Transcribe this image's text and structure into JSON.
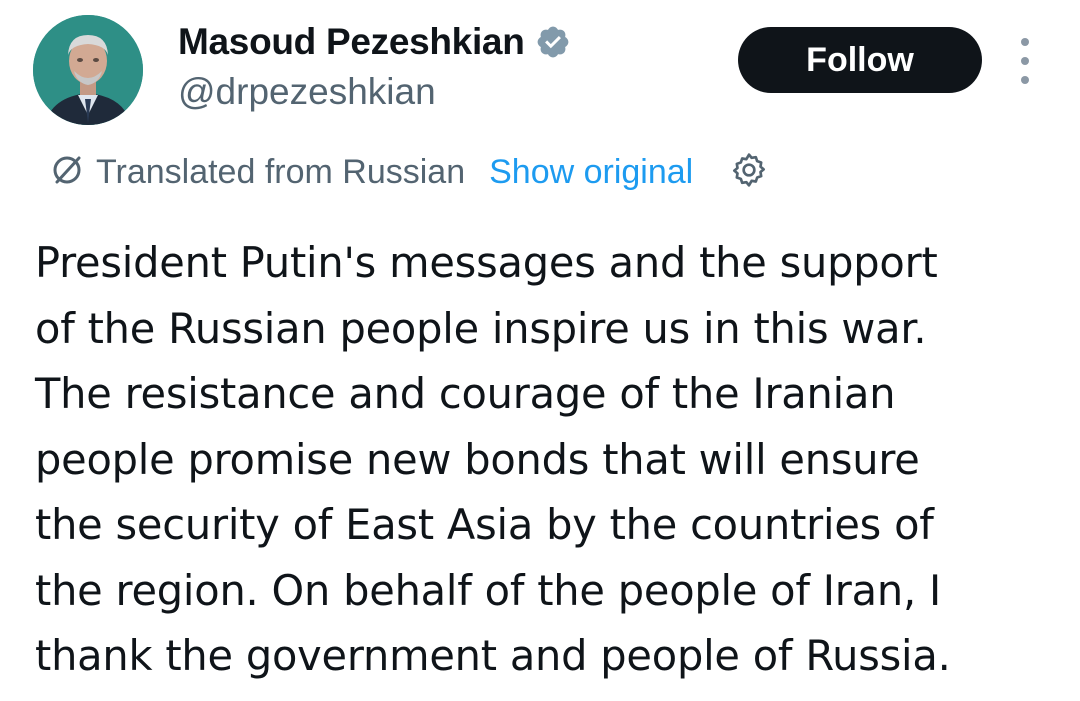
{
  "author": {
    "display_name": "Masoud Pezeshkian",
    "handle": "@drpezeshkian",
    "verified_icon": "verified-badge",
    "avatar_icon": "profile-photo"
  },
  "actions": {
    "follow_label": "Follow",
    "more_icon": "more-vertical"
  },
  "translation": {
    "icon": "translate-icon",
    "label": "Translated from Russian",
    "show_original_label": "Show original",
    "settings_icon": "gear-icon"
  },
  "tweet": {
    "lines": [
      "President Putin's messages and the support",
      "of the Russian people inspire us in this war.",
      "The resistance and courage of the Iranian",
      "people promise new bonds that will ensure",
      "the security of East Asia by the countries of",
      "the region. On behalf of the people of Iran, I",
      "thank the government and people of Russia."
    ]
  },
  "colors": {
    "text_primary": "#0f1419",
    "text_secondary": "#536471",
    "link": "#1d9bf0",
    "follow_bg": "#0f1419",
    "verified_badge": "#829aab",
    "avatar_bg": "#2e8f86"
  }
}
